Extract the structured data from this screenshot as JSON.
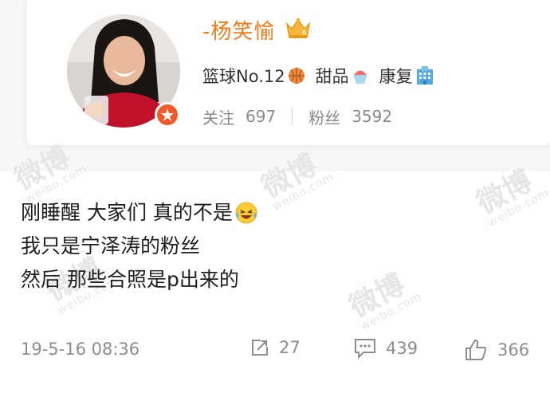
{
  "profile": {
    "username": "-杨笑愉",
    "tags": [
      {
        "label": "篮球No.12",
        "icon": "basketball-icon"
      },
      {
        "label": "甜品",
        "icon": "shaved-ice-icon"
      },
      {
        "label": "康复",
        "icon": "hospital-icon"
      }
    ],
    "stats": {
      "follow_label": "关注",
      "follow_count": "697",
      "fans_label": "粉丝",
      "fans_count": "3592"
    },
    "verified_icon": "verified-badge-icon",
    "vip_icon": "crown-icon"
  },
  "post": {
    "lines": [
      "刚睡醒 大家们 真的不是",
      "我只是宁泽涛的粉丝",
      "然后 那些合照是p出来的"
    ],
    "emoji": "laughing-crying-icon"
  },
  "meta": {
    "timestamp": "19-5-16 08:36",
    "repost_count": "27",
    "comment_count": "439",
    "like_count": "366"
  },
  "watermark": {
    "text": "微博",
    "subtext": "weibo.com"
  },
  "colors": {
    "username": "#f07b19",
    "badge": "#f05a28",
    "text": "#1f1f1f",
    "meta": "#8d8d8d"
  }
}
